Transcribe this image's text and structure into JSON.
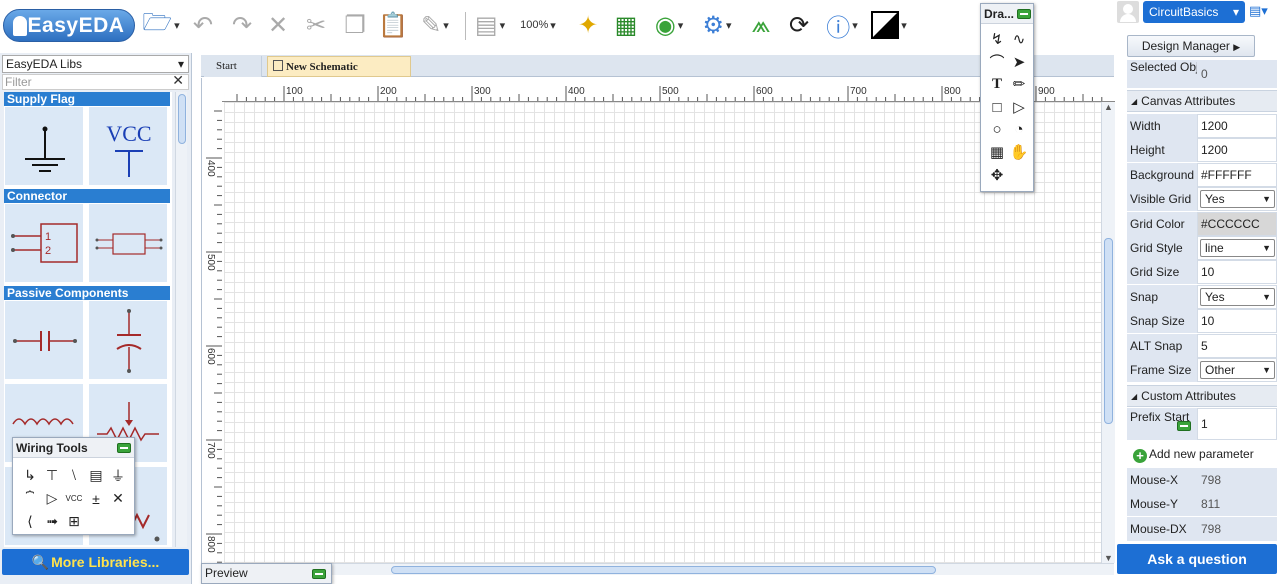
{
  "app": {
    "logo_text": "EasyEDA",
    "zoom": "100%"
  },
  "toolbar_icons": [
    "open-icon",
    "undo-icon",
    "redo-icon",
    "delete-icon",
    "cut-icon",
    "copy-icon",
    "paste-icon",
    "route-icon",
    "align-icon",
    "zoom-icon",
    "magic-wand-icon",
    "pcb-icon",
    "simulate-icon",
    "gear-icon",
    "share-icon",
    "history-icon",
    "info-icon",
    "theme-icon"
  ],
  "user": {
    "name": "CircuitBasics"
  },
  "library": {
    "selector": "EasyEDA Libs",
    "filter_placeholder": "Filter",
    "categories": [
      {
        "name": "Supply Flag"
      },
      {
        "name": "Connector"
      },
      {
        "name": "Passive Components"
      }
    ],
    "vcc_label": "VCC",
    "more_button": "More Libraries..."
  },
  "wiring_tools": {
    "title": "Wiring Tools",
    "tools": [
      "wire",
      "bus",
      "bus-entry",
      "netlabel",
      "net-flag-gnd",
      "net-port",
      "net-flag-vcc",
      "net-flag-plus",
      "voltage-probe",
      "no-connect",
      "pin",
      "group"
    ]
  },
  "tabs": [
    {
      "label": "Start"
    },
    {
      "label": "New Schematic"
    }
  ],
  "ruler": {
    "h_labels": [
      "100",
      "200",
      "300",
      "400",
      "500",
      "600",
      "700",
      "800",
      "900"
    ],
    "v_labels": [
      "400",
      "500",
      "600",
      "700",
      "800"
    ]
  },
  "drawing_tools": {
    "title": "Dra...",
    "tools": [
      "polyline",
      "bezier",
      "arc",
      "arrowhead",
      "text",
      "freehand",
      "rect",
      "polygon",
      "ellipse",
      "pie",
      "image",
      "drag",
      "canvas-origin"
    ]
  },
  "preview": {
    "title": "Preview"
  },
  "properties": {
    "design_manager": "Design Manager",
    "selected_objects": {
      "label": "Selected Objects",
      "value": "0"
    },
    "canvas_section": "Canvas Attributes",
    "rows": [
      {
        "label": "Width",
        "value": "1200",
        "kind": "input"
      },
      {
        "label": "Height",
        "value": "1200",
        "kind": "input"
      },
      {
        "label": "Background",
        "value": "#FFFFFF",
        "kind": "input"
      },
      {
        "label": "Visible Grid",
        "value": "Yes",
        "kind": "select"
      },
      {
        "label": "Grid Color",
        "value": "#CCCCCC",
        "kind": "gray"
      },
      {
        "label": "Grid Style",
        "value": "line",
        "kind": "select"
      },
      {
        "label": "Grid Size",
        "value": "10",
        "kind": "input"
      },
      {
        "label": "Snap",
        "value": "Yes",
        "kind": "select"
      },
      {
        "label": "Snap Size",
        "value": "10",
        "kind": "input"
      },
      {
        "label": "ALT Snap",
        "value": "5",
        "kind": "input"
      },
      {
        "label": "Frame Size",
        "value": "Other",
        "kind": "select"
      }
    ],
    "custom_section": "Custom Attributes",
    "prefix_start": {
      "label": "Prefix Start",
      "value": "1"
    },
    "add_param": "Add new parameter",
    "mouse": [
      {
        "label": "Mouse-X",
        "value": "798"
      },
      {
        "label": "Mouse-Y",
        "value": "811"
      },
      {
        "label": "Mouse-DX",
        "value": "798"
      }
    ],
    "ask_button": "Ask a question"
  },
  "colors": {
    "accent_blue": "#1d6fd4",
    "category_blue": "#2a7ed1",
    "more_libs_text": "#ffe34d",
    "active_tab": "#fcecc2",
    "symbol_red": "#a52a2a",
    "vcc_blue": "#1a3fb5"
  }
}
